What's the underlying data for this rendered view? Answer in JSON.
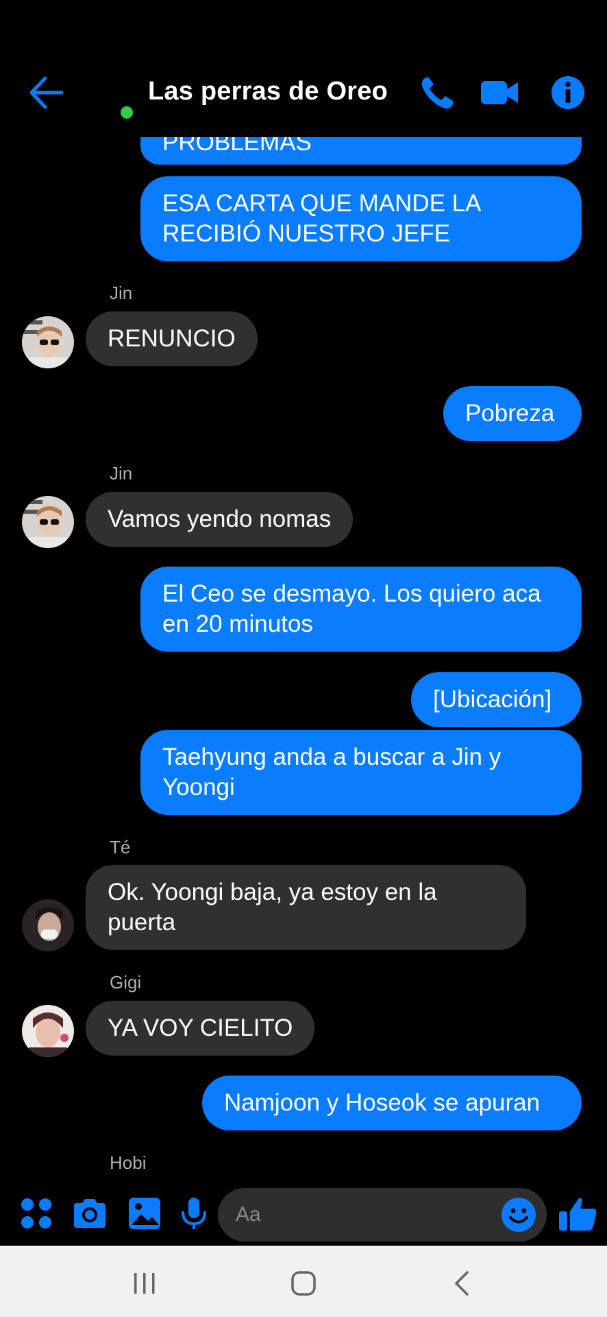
{
  "header": {
    "title": "Las perras de Oreo",
    "back_icon": "arrow-left-icon",
    "actions": [
      "phone-icon",
      "video-camera-icon",
      "info-icon"
    ],
    "accent_color": "#0a7cff",
    "presence_color": "#31cc46"
  },
  "messages": [
    {
      "dir": "out",
      "text": "PROBLEMAS"
    },
    {
      "dir": "out",
      "line1": "ESA CARTA QUE MANDE LA",
      "line2": "RECIBIÓ NUESTRO JEFE"
    },
    {
      "dir": "in",
      "sender": "Jin",
      "text": "RENUNCIO"
    },
    {
      "dir": "out",
      "text": "Pobreza"
    },
    {
      "dir": "in",
      "sender": "Jin",
      "text": "Vamos yendo nomas"
    },
    {
      "dir": "out",
      "line1": "El Ceo se desmayo. Los quiero aca",
      "line2": "en 20 minutos"
    },
    {
      "dir": "out",
      "text": "[Ubicación]"
    },
    {
      "dir": "out",
      "line1": "Taehyung anda a buscar a Jin y",
      "line2": "Yoongi"
    },
    {
      "dir": "in",
      "sender": "Té",
      "line1": "Ok. Yoongi baja, ya estoy en la",
      "line2": "puerta"
    },
    {
      "dir": "in",
      "sender": "Gigi",
      "text": "YA VOY CIELITO"
    },
    {
      "dir": "out",
      "text": "Namjoon y Hoseok se apuran"
    },
    {
      "dir": "in",
      "sender": "Hobi"
    }
  ],
  "composer": {
    "placeholder": "Aa",
    "icons": [
      "apps-grid-icon",
      "camera-icon",
      "gallery-icon",
      "microphone-icon",
      "emoji-icon",
      "thumbs-up-icon"
    ]
  },
  "navbar": {
    "buttons": [
      "recents-icon",
      "home-icon",
      "back-icon"
    ]
  }
}
